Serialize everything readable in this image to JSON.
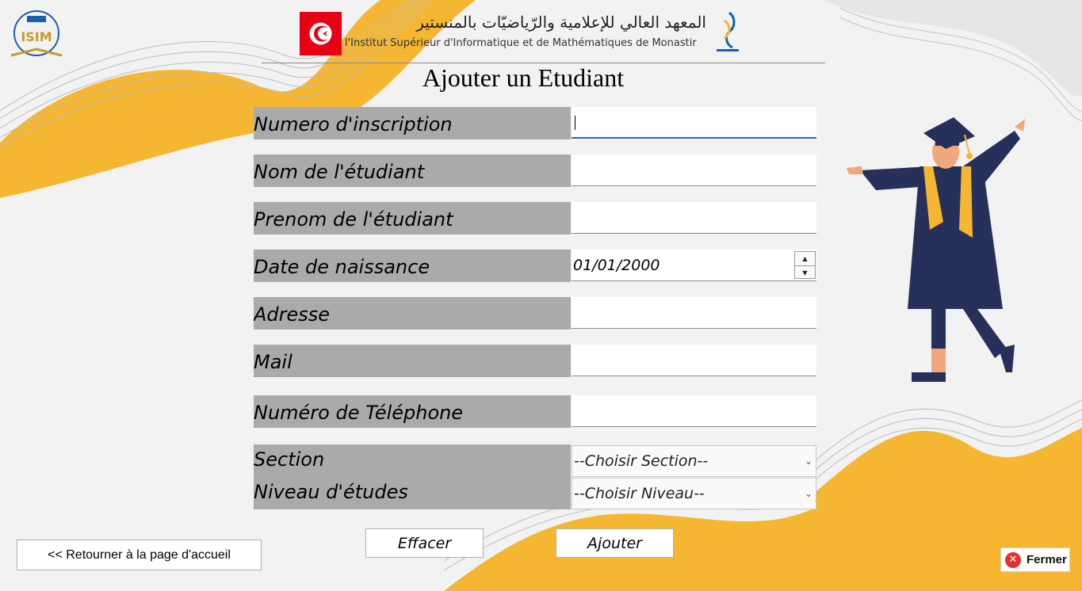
{
  "header": {
    "arabic_title": "المعهد العالي للإعلامية والرّياضيّات بالمنستير",
    "french_title": "l'Institut Supérieur d'Informatique et de Mathématiques de Monastir"
  },
  "page_title": "Ajouter un Etudiant",
  "form": {
    "fields": [
      {
        "label": "Numero d'inscription",
        "value": ""
      },
      {
        "label": "Nom de l'étudiant",
        "value": ""
      },
      {
        "label": "Prenom de l'étudiant",
        "value": ""
      },
      {
        "label": "Date de naissance",
        "value": "01/01/2000"
      },
      {
        "label": "Adresse",
        "value": ""
      },
      {
        "label": "Mail",
        "value": ""
      },
      {
        "label": "Numéro de Téléphone",
        "value": ""
      }
    ],
    "section": {
      "label": "Section",
      "selected": "--Choisir Section--"
    },
    "niveau": {
      "label": "Niveau d'études",
      "selected": "--Choisir Niveau--"
    }
  },
  "buttons": {
    "clear": "Effacer",
    "add": "Ajouter",
    "home": "<< Retourner à la page d'accueil",
    "close": "Fermer"
  },
  "icons": {
    "spin_up": "▲",
    "spin_down": "▼",
    "dropdown": "⌄",
    "close": "✕"
  },
  "colors": {
    "accent_yellow": "#f5b731",
    "label_bg": "#aaaaaa",
    "gown_navy": "#27305a",
    "flag_red": "#e70013",
    "close_red": "#e0322f"
  }
}
